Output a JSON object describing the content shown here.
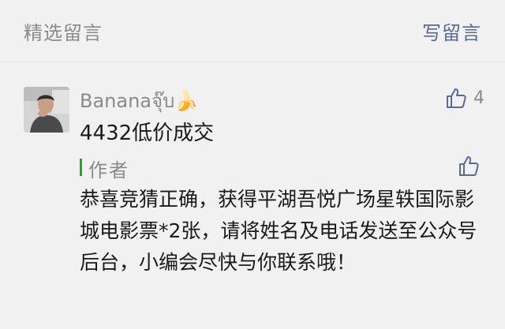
{
  "header": {
    "title": "精选留言",
    "write_label": "写留言"
  },
  "comment": {
    "nickname": "Bananaจุ๊บ🍌",
    "like_count": "4",
    "text": "4432低价成交"
  },
  "reply": {
    "author_label": "作者",
    "text": "恭喜竞猜正确，获得平湖吾悦广场星轶国际影城电影票*2张，请将姓名及电话发送至公众号后台，小编会尽快与你联系哦！"
  },
  "icons": {
    "like": "thumbs-up-icon",
    "reply_like": "thumbs-up-icon"
  },
  "colors": {
    "link": "#576b95",
    "author_bar": "#1aad19",
    "muted_text": "#8b8b8b",
    "background": "#f1f1f1"
  }
}
